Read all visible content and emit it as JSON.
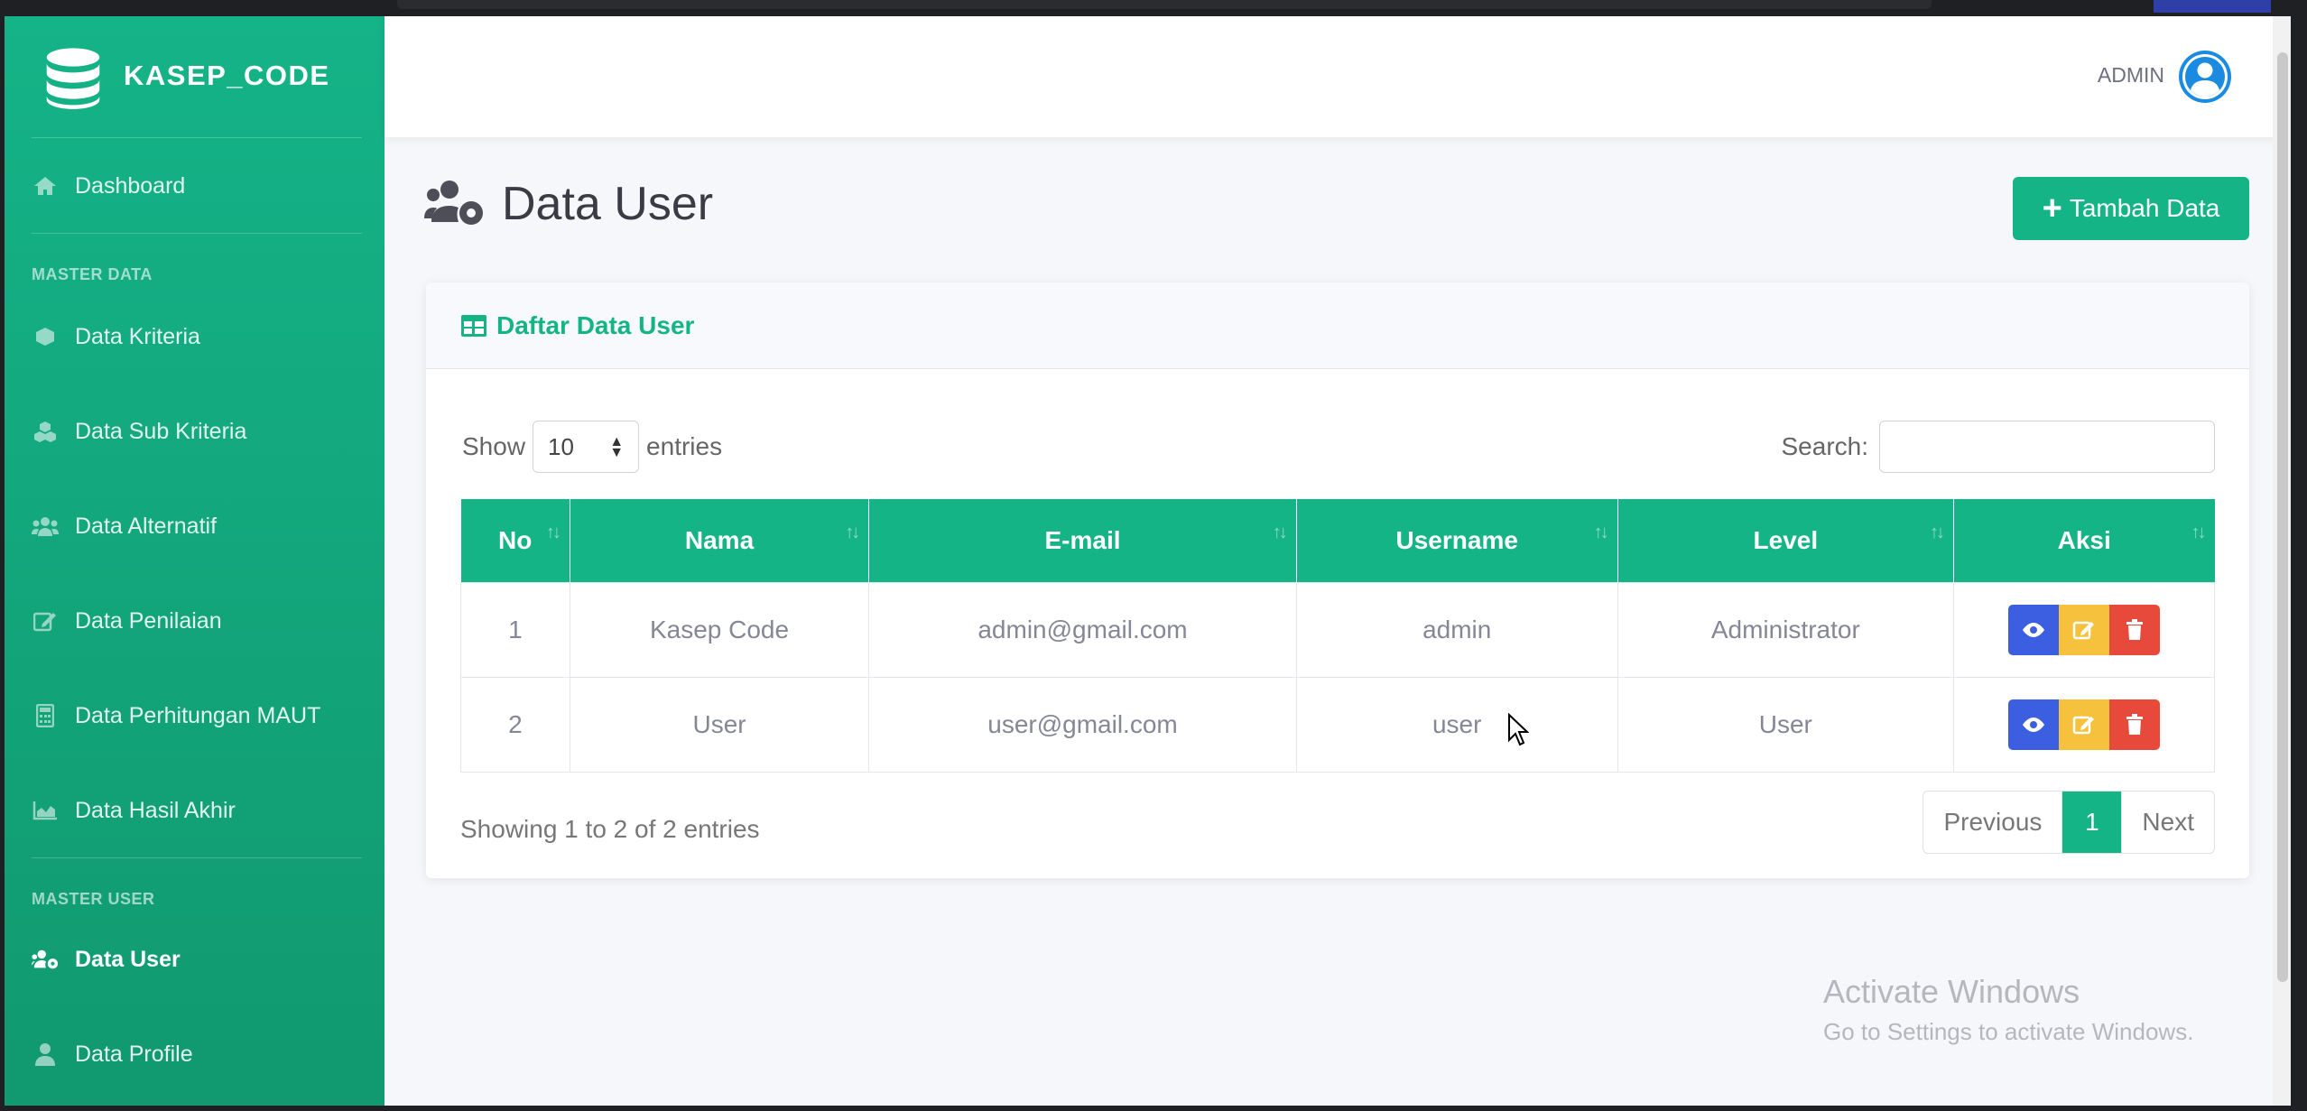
{
  "brand": {
    "name": "KASEP_CODE"
  },
  "sidebar": {
    "dashboard": "Dashboard",
    "master_data_label": "MASTER DATA",
    "items": [
      {
        "label": "Data Kriteria",
        "icon": "cube-icon"
      },
      {
        "label": "Data Sub Kriteria",
        "icon": "cubes-icon"
      },
      {
        "label": "Data Alternatif",
        "icon": "users-icon"
      },
      {
        "label": "Data Penilaian",
        "icon": "edit-icon"
      },
      {
        "label": "Data Perhitungan MAUT",
        "icon": "calculator-icon"
      },
      {
        "label": "Data Hasil Akhir",
        "icon": "chart-area-icon"
      }
    ],
    "master_user_label": "MASTER USER",
    "user_items": [
      {
        "label": "Data User",
        "icon": "users-cog-icon",
        "active": true
      },
      {
        "label": "Data Profile",
        "icon": "user-icon"
      }
    ]
  },
  "topbar": {
    "username": "ADMIN"
  },
  "page": {
    "title": "Data User",
    "add_button": "Tambah Data"
  },
  "card": {
    "title": "Daftar Data User",
    "show_label": "Show",
    "entries_label": "entries",
    "page_length": "10",
    "search_label": "Search:",
    "search_value": ""
  },
  "table": {
    "headers": [
      "No",
      "Nama",
      "E-mail",
      "Username",
      "Level",
      "Aksi"
    ],
    "rows": [
      {
        "no": "1",
        "nama": "Kasep Code",
        "email": "admin@gmail.com",
        "username": "admin",
        "level": "Administrator"
      },
      {
        "no": "2",
        "nama": "User",
        "email": "user@gmail.com",
        "username": "user",
        "level": "User"
      }
    ]
  },
  "footer": {
    "info": "Showing 1 to 2 of 2 entries",
    "prev": "Previous",
    "current": "1",
    "next": "Next"
  },
  "watermark": {
    "line1": "Activate Windows",
    "line2": "Go to Settings to activate Windows."
  },
  "colors": {
    "primary": "#14b487",
    "view": "#3b5fe0",
    "edit": "#f6c23e",
    "delete": "#e74a3b"
  }
}
